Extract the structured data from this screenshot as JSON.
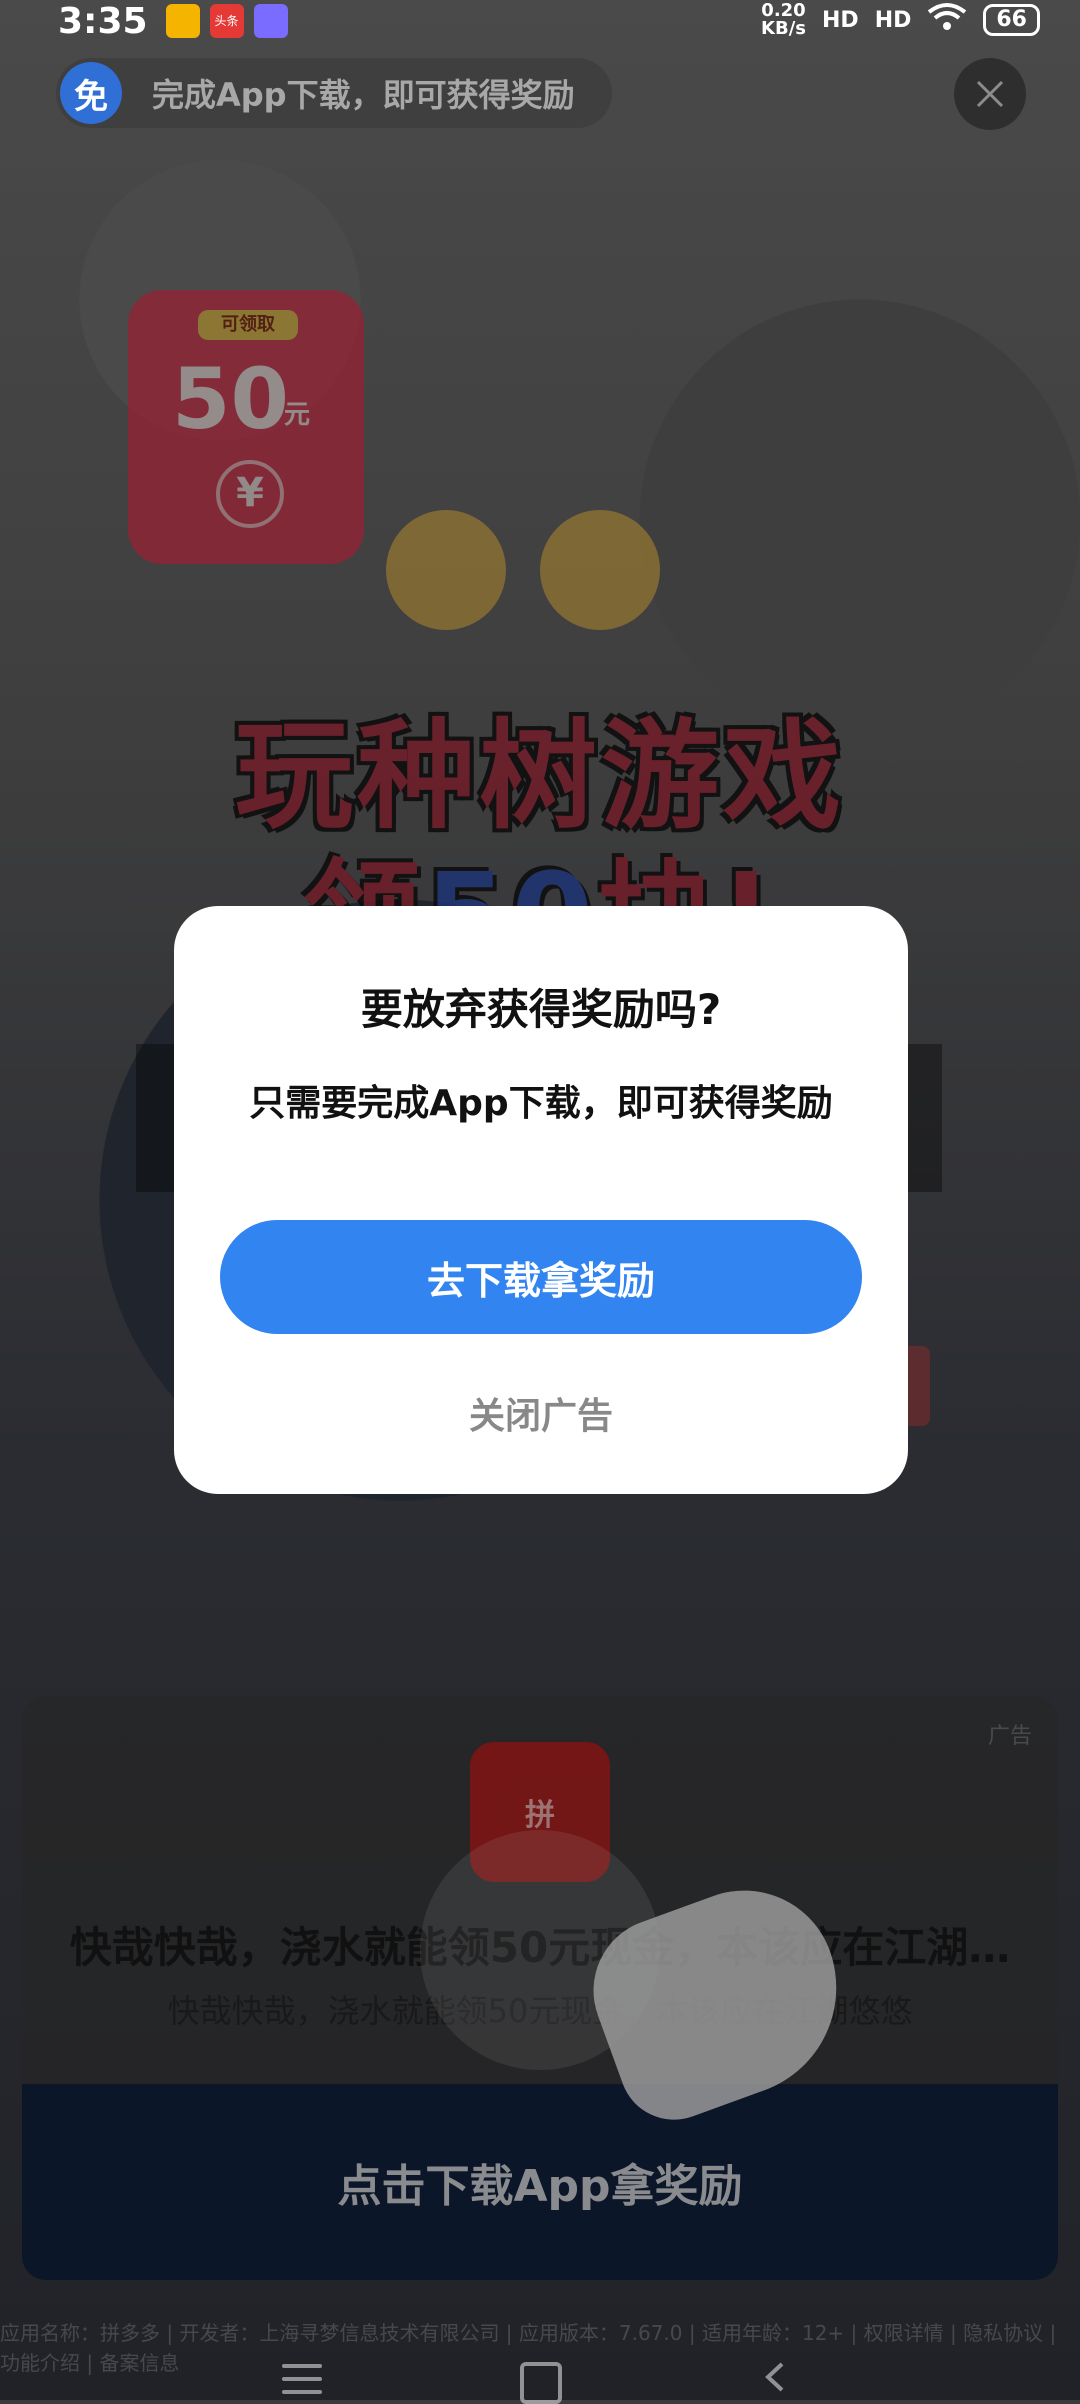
{
  "status_bar": {
    "time": "3:35",
    "net_speed_value": "0.20",
    "net_speed_unit": "KB/s",
    "signal1": "HD",
    "signal2": "HD",
    "battery": "66"
  },
  "notifications": [
    {
      "icon": "notes-app-icon",
      "label": ""
    },
    {
      "icon": "toutiao-app-icon",
      "label": "头条"
    },
    {
      "icon": "game-app-icon",
      "label": ""
    }
  ],
  "top_banner": {
    "badge": "免",
    "text": "完成App下载，即可获得奖励"
  },
  "ad_art": {
    "tag": "可领取",
    "amount": "50",
    "unit": "元",
    "coin": "¥",
    "headline1": "玩种树游戏",
    "headline2_red": "领",
    "headline2_blue": "50",
    "headline2_rest": "块!"
  },
  "card": {
    "ad_label": "广告",
    "app_icon_text": "拼",
    "title": "快哉快哉，浇水就能领50元现金，本该应在江湖…",
    "subtitle": "快哉快哉，浇水就能领50元现金，本该应在江湖悠悠",
    "cta": "点击下载App拿奖励"
  },
  "footer": {
    "info": "应用名称：拼多多 | 开发者：上海寻梦信息技术有限公司 | 应用版本：7.67.0 | 适用年龄：12+ | 权限详情 | 隐私协议 | 功能介绍 | 备案信息"
  },
  "modal": {
    "title": "要放弃获得奖励吗?",
    "body": "只需要完成App下载，即可获得奖励",
    "primary_label": "去下载拿奖励",
    "secondary_label": "关闭广告"
  },
  "colors": {
    "primary_button": "#3285f0",
    "modal_bg": "#ffffff",
    "secondary_text": "#888888"
  }
}
